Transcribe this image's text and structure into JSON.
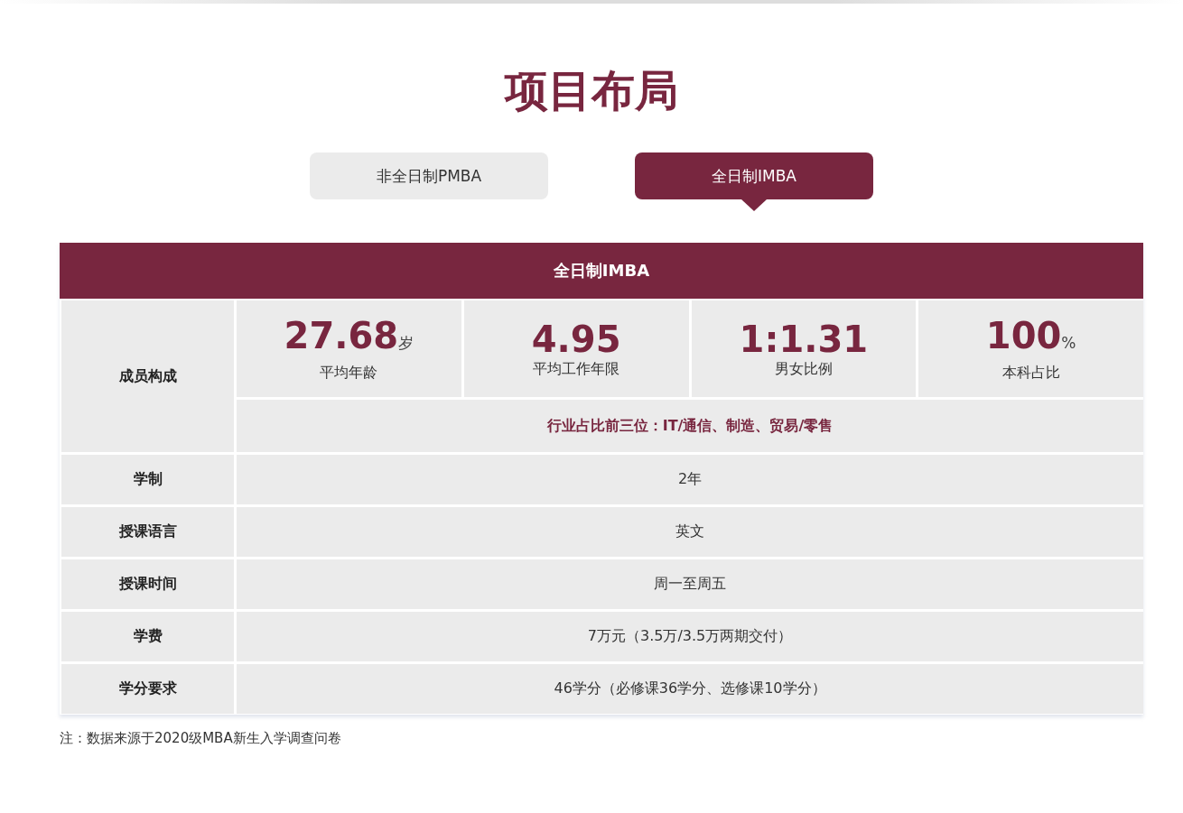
{
  "title": "项目布局",
  "tabs": [
    {
      "label": "非全日制PMBA",
      "selected": false
    },
    {
      "label": "全日制IMBA",
      "selected": true
    }
  ],
  "table": {
    "header": "全日制IMBA",
    "composition": {
      "label": "成员构成",
      "stats": [
        {
          "value": "27.68",
          "unit": "岁",
          "caption": "平均年龄"
        },
        {
          "value": "4.95",
          "caption": "平均工作年限"
        },
        {
          "value": "1:1.31",
          "caption": "男女比例"
        },
        {
          "value": "100",
          "unit": "%",
          "caption": "本科占比"
        }
      ],
      "industry": "行业占比前三位：IT/通信、制造、贸易/零售"
    },
    "rows": [
      {
        "label": "学制",
        "value": "2年"
      },
      {
        "label": "授课语言",
        "value": "英文"
      },
      {
        "label": "授课时间",
        "value": "周一至周五"
      },
      {
        "label": "学费",
        "value": "7万元（3.5万/3.5万两期交付）"
      },
      {
        "label": "学分要求",
        "value": "46学分（必修课36学分、选修课10学分）"
      }
    ]
  },
  "note": "注：数据来源于2020级MBA新生入学调查问卷"
}
